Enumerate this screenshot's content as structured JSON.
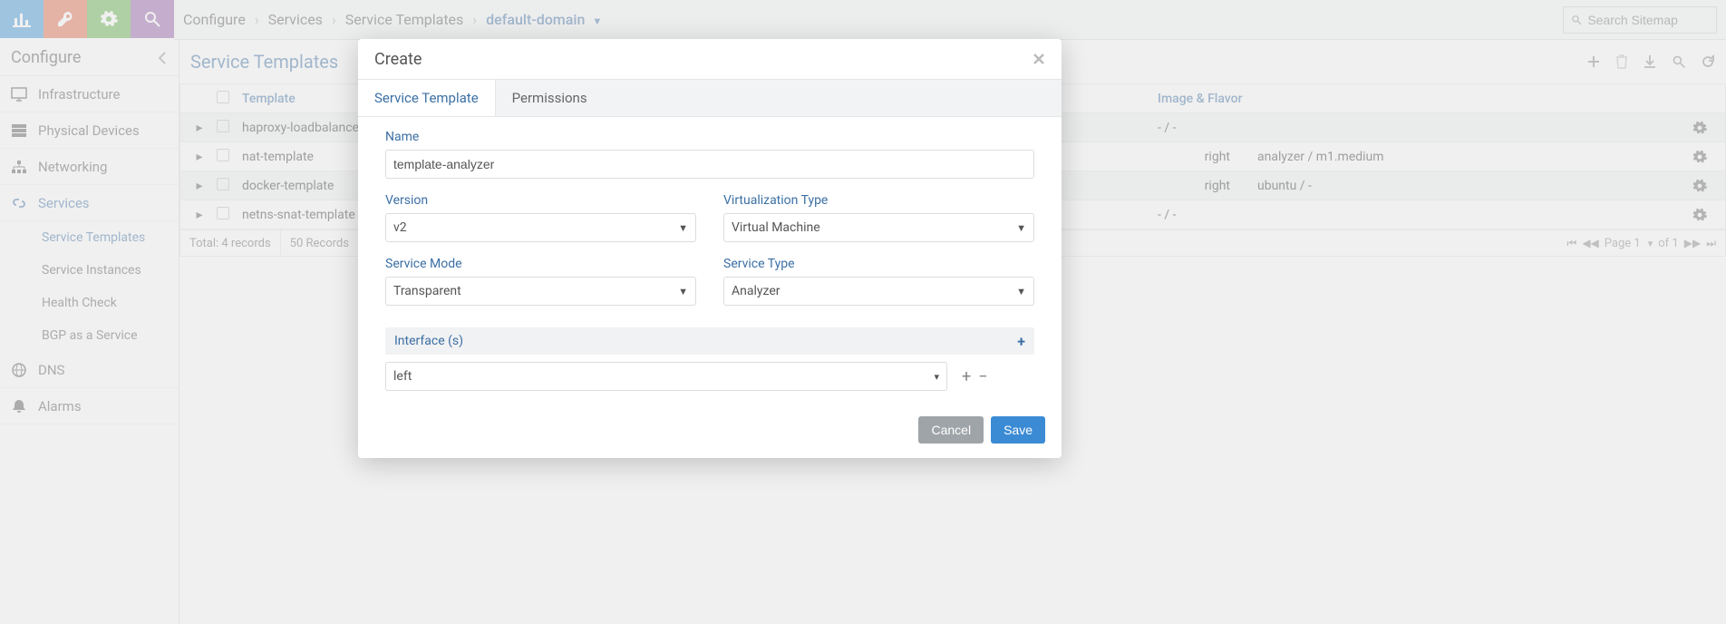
{
  "topbar": {
    "breadcrumb": [
      "Configure",
      "Services",
      "Service Templates"
    ],
    "breadcrumb_active": "default-domain",
    "search_placeholder": "Search Sitemap"
  },
  "sidebar": {
    "header": "Configure",
    "items": [
      {
        "label": "Infrastructure",
        "icon": "layers"
      },
      {
        "label": "Physical Devices",
        "icon": "bars"
      },
      {
        "label": "Networking",
        "icon": "sitemap"
      },
      {
        "label": "Services",
        "icon": "link",
        "active": true,
        "children": [
          {
            "label": "Service Templates",
            "active": true
          },
          {
            "label": "Service Instances"
          },
          {
            "label": "Health Check"
          },
          {
            "label": "BGP as a Service"
          }
        ]
      },
      {
        "label": "DNS",
        "icon": "globe"
      },
      {
        "label": "Alarms",
        "icon": "bell"
      }
    ]
  },
  "content": {
    "title": "Service Templates",
    "columns": {
      "template": "Template",
      "image_flavor": "Image & Flavor"
    },
    "rows": [
      {
        "template": "haproxy-loadbalancer-template",
        "hidden": "",
        "image_flavor": "- / -"
      },
      {
        "template": "nat-template",
        "hidden": "right",
        "image_flavor": "analyzer / m1.medium"
      },
      {
        "template": "docker-template",
        "hidden": "right",
        "image_flavor": "ubuntu / -"
      },
      {
        "template": "netns-snat-template",
        "hidden": "",
        "image_flavor": "- / -"
      }
    ],
    "footer": {
      "total": "Total: 4 records",
      "page_size": "50 Records",
      "page_label": "Page 1",
      "page_of": "of 1"
    }
  },
  "modal": {
    "title": "Create",
    "tabs": {
      "service_template": "Service Template",
      "permissions": "Permissions"
    },
    "fields": {
      "name_label": "Name",
      "name_value": "template-analyzer",
      "version_label": "Version",
      "version_value": "v2",
      "virt_label": "Virtualization Type",
      "virt_value": "Virtual Machine",
      "mode_label": "Service Mode",
      "mode_value": "Transparent",
      "type_label": "Service Type",
      "type_value": "Analyzer",
      "interfaces_label": "Interface (s)",
      "interface_value": "left"
    },
    "buttons": {
      "cancel": "Cancel",
      "save": "Save"
    }
  },
  "colors": {
    "blue_btn": "#3691d6",
    "orange_btn": "#e16646",
    "green_btn": "#5cae41",
    "purple_btn": "#935aa8"
  }
}
